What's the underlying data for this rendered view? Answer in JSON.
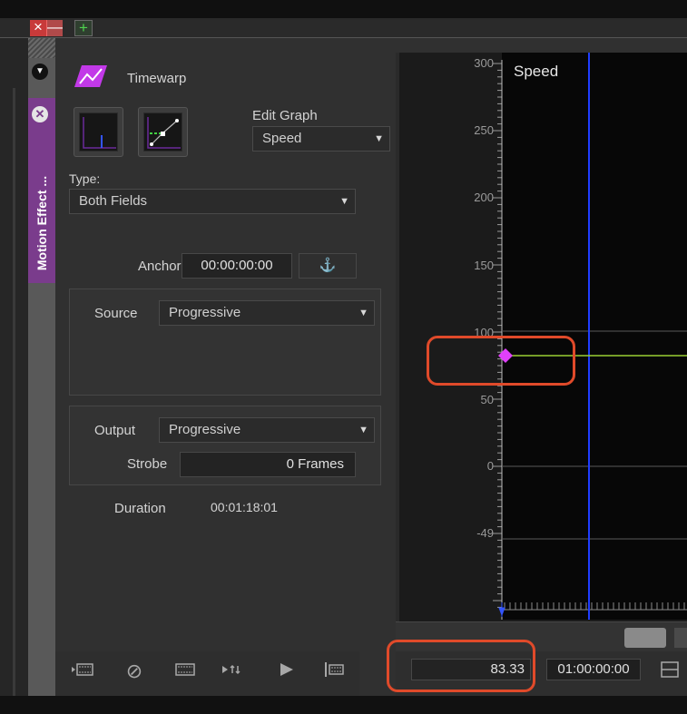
{
  "window": {
    "close_glyph": "×",
    "minimize_glyph": "—",
    "add_glyph": "+"
  },
  "tab": {
    "label": "Motion Effect ...",
    "close_glyph": "✕",
    "menu_glyph": "▼",
    "accent_color": "#7a3c8c"
  },
  "effect": {
    "name": "Timewarp",
    "icon": "timewarp-icon",
    "edit_graph_label": "Edit Graph",
    "edit_graph_value": "Speed",
    "type_label": "Type:",
    "type_value": "Both Fields",
    "anchor_label": "Anchor",
    "anchor_value": "00:00:00:00",
    "anchor_button_glyph": "⚓",
    "source_label": "Source",
    "source_value": "Progressive",
    "output_label": "Output",
    "output_value": "Progressive",
    "strobe_label": "Strobe",
    "strobe_value": "0 Frames",
    "duration_label": "Duration",
    "duration_value": "00:01:18:01"
  },
  "graph": {
    "title": "Speed",
    "y_ticks": [
      "300",
      "250",
      "200",
      "150",
      "100",
      "50",
      "0",
      "-49"
    ],
    "curve_color": "#9acd32",
    "playhead_color": "#1f3dff",
    "keyframe_color": "#e040fb",
    "keyframe_value": 83.33
  },
  "bottom": {
    "value_field": "83.33",
    "timecode_field": "01:00:00:00",
    "toolbar_icons": [
      "render-in-icon",
      "disable-icon",
      "filmstrip-icon",
      "play-loop-icon",
      "play-icon",
      "end-marker-icon"
    ]
  },
  "annotations": {
    "highlight_color": "#e04a2a"
  }
}
